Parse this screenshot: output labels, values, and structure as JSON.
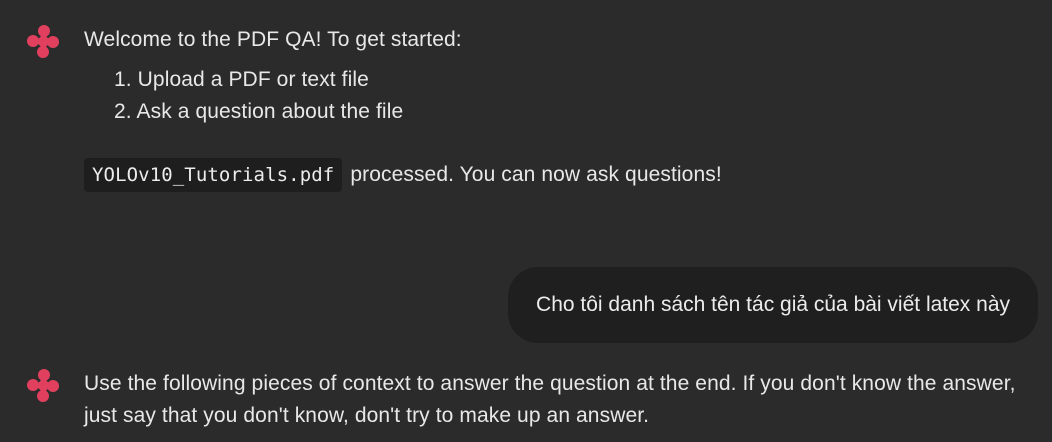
{
  "messages": {
    "welcome": {
      "text": "Welcome to the PDF QA! To get started:",
      "steps": [
        "1. Upload a PDF or text file",
        "2. Ask a question about the file"
      ]
    },
    "processed": {
      "filename": "YOLOv10_Tutorials.pdf",
      "text": "processed. You can now ask questions!"
    },
    "user_question": "Cho tôi danh sách tên tác giả của bài viết latex này",
    "answer": "Use the following pieces of context to answer the question at the end. If you don't know the answer, just say that you don't know, don't try to make up an answer."
  },
  "colors": {
    "background": "#2b2b2b",
    "avatar": "#e0405e",
    "user_bubble": "#1f1f1f",
    "code_chip": "#1e1e1e"
  },
  "icons": {
    "assistant_avatar": "chainlit-logo-icon"
  }
}
